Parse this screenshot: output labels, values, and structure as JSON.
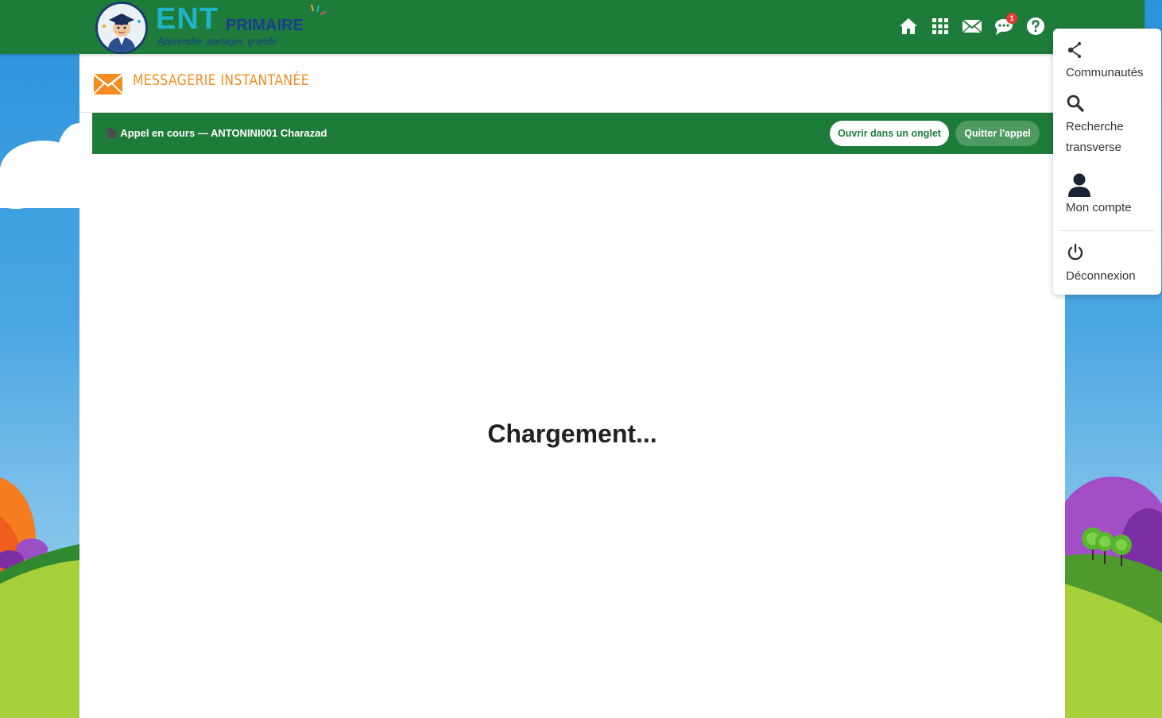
{
  "logo": {
    "ent": "ENT",
    "primaire": "PRIMAIRE",
    "tagline": "Apprendre, partager, grandir."
  },
  "nav": {
    "icons": [
      "home-icon",
      "apps-grid-icon",
      "mail-icon",
      "chat-icon",
      "help-icon"
    ],
    "chat_badge": "1"
  },
  "app": {
    "title": "MESSAGERIE INSTANTANÉE"
  },
  "call": {
    "status": "🎥 Appel en cours — ANTONINI001 Charazad",
    "open_tab_label": "Ouvrir dans un onglet",
    "quit_label": "Quitter l'appel"
  },
  "content": {
    "loading": "Chargement..."
  },
  "menu": {
    "communities": "Communautés",
    "search_line1": "Recherche",
    "search_line2": "transverse",
    "account": "Mon compte",
    "logout": "Déconnexion"
  },
  "colors": {
    "green": "#1e7c3a",
    "orange": "#f58a1f",
    "sky": "#2a93dc"
  }
}
